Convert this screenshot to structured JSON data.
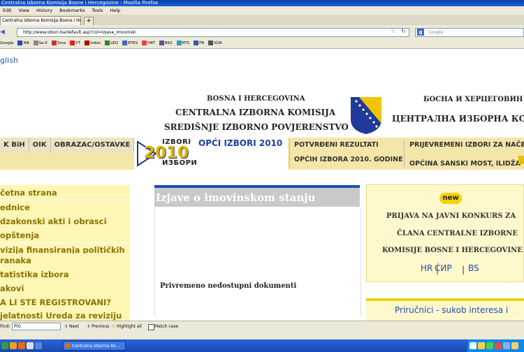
{
  "browser": {
    "window_title": "Centralna Izborna Komisija Bosne i Hercegovine - Mozilla Firefox",
    "menu": [
      "Edit",
      "View",
      "History",
      "Bookmarks",
      "Tools",
      "Help"
    ],
    "tab_title": "Centralna Izborna Komisija Bosne i Hercegov...",
    "new_tab_label": "+",
    "url": "http://www.izbori.ba/default.asp?col=Izjave_Imovinski",
    "search_placeholder": "Google",
    "search_engine_letter": "g",
    "bookmarks": [
      "Google",
      "NN",
      "Sa-X",
      "Sma",
      "YT",
      "Index",
      "LEO",
      "RTRS",
      "HRT",
      "B92",
      "RTS",
      "FB",
      "XDA"
    ]
  },
  "page": {
    "language_link": "glish",
    "header_latin": {
      "line1": "BOSNA I HERCEGOVINA",
      "line2": "CENTRALNA IZBORNA KOMISIJA",
      "line3": "SREDIŠNJE IZBORNO POVJERENSTVO"
    },
    "header_cyrillic": {
      "line1": "БОСНА И ХЕРЦЕГОВИН",
      "line2": "ЦЕНТРАЛНА ИЗБОРНА КО"
    },
    "nav_left": [
      "K BiH",
      "OIK",
      "OBRAZAC/OSTAVKE"
    ],
    "logo": {
      "top": "IZBORI",
      "year": "2010",
      "bottom": "ИЗБОРИ",
      "title": "OPĆI IZBORI 2010"
    },
    "nav_right": {
      "item1_line1": "POTVRĐENI REZULTATI",
      "item1_line2": "OPĆIH IZBORA 2010. GODINE",
      "item2_line1": "PRIJEVREMENI IZBORI ZA NAČE",
      "item2_line2": "OPĆINA SANSKI MOST, ILIDŽA"
    },
    "sidebar": [
      "četna strana",
      "ednice",
      "dzakonski akti i obrasci",
      "opštenja",
      "vizija finansiranja političkih",
      "ranaka",
      "tatistika izbora",
      "akovi",
      "A LI STE REGISTROVANI?",
      "jelatnosti Ureda za reviziju"
    ],
    "main": {
      "title": "Izjave o imovinskom stanju",
      "message": "Privremeno nedostupni dokumenti"
    },
    "right_panel": {
      "badge": "new",
      "line1": "PRIJAVA NA JAVNI KONKURS ZA",
      "line2": "ČLANA CENTRALNE IZBORNE",
      "line3": "KOMISIJE BOSNE I HERCEGOVINE",
      "links": [
        "HR",
        "ĆИР",
        "BS"
      ],
      "separator": "|",
      "second_title": "Priručnici - sukob interesa i"
    }
  },
  "findbar": {
    "label": "Find:",
    "value": "PIO",
    "next": "Next",
    "previous": "Previous",
    "highlight": "Highlight all",
    "match_case": "Match case"
  },
  "taskbar": {
    "task_title": "Centralna Izborna Ko..."
  },
  "colors": {
    "accent_blue": "#1f4fb0",
    "nav_yellow": "#f3e6a8",
    "sidebar_text": "#8a7400",
    "badge_yellow": "#f2d200"
  }
}
